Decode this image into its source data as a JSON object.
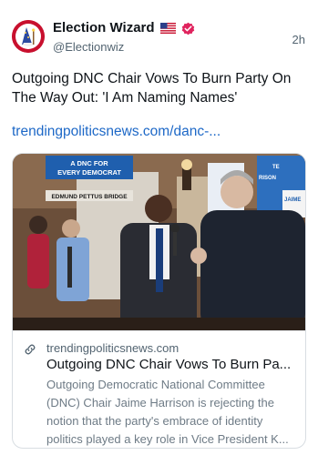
{
  "post": {
    "author_name": "Election Wizard",
    "handle": "@Electionwiz",
    "timestamp": "2h",
    "text": "Outgoing DNC Chair Vows To Burn Party On The Way Out: 'I Am Naming Names'",
    "link": "trendingpoliticsnews.com/danc-..."
  },
  "card": {
    "image_text": {
      "sign_line1": "A DNC FOR",
      "sign_line2": "EVERY DEMOCRAT",
      "banner": "EDMUND PETTUS BRIDGE",
      "side_top": "TE",
      "side_mid": "RISON",
      "side_brand": "JAIME"
    },
    "domain": "trendingpoliticsnews.com",
    "title": "Outgoing DNC Chair Vows To Burn Pa...",
    "description": "Outgoing Democratic National Committee (DNC) Chair Jaime Harrison is rejecting the notion that the party's embrace of identity politics played a key role in Vice President K..."
  },
  "colors": {
    "link": "#1d68c7",
    "verified": "#e0245e",
    "avatar_bg": "#c8102e"
  },
  "icons": {
    "flag": "us-flag-icon",
    "verified": "verified-badge-icon",
    "link": "link-icon"
  }
}
